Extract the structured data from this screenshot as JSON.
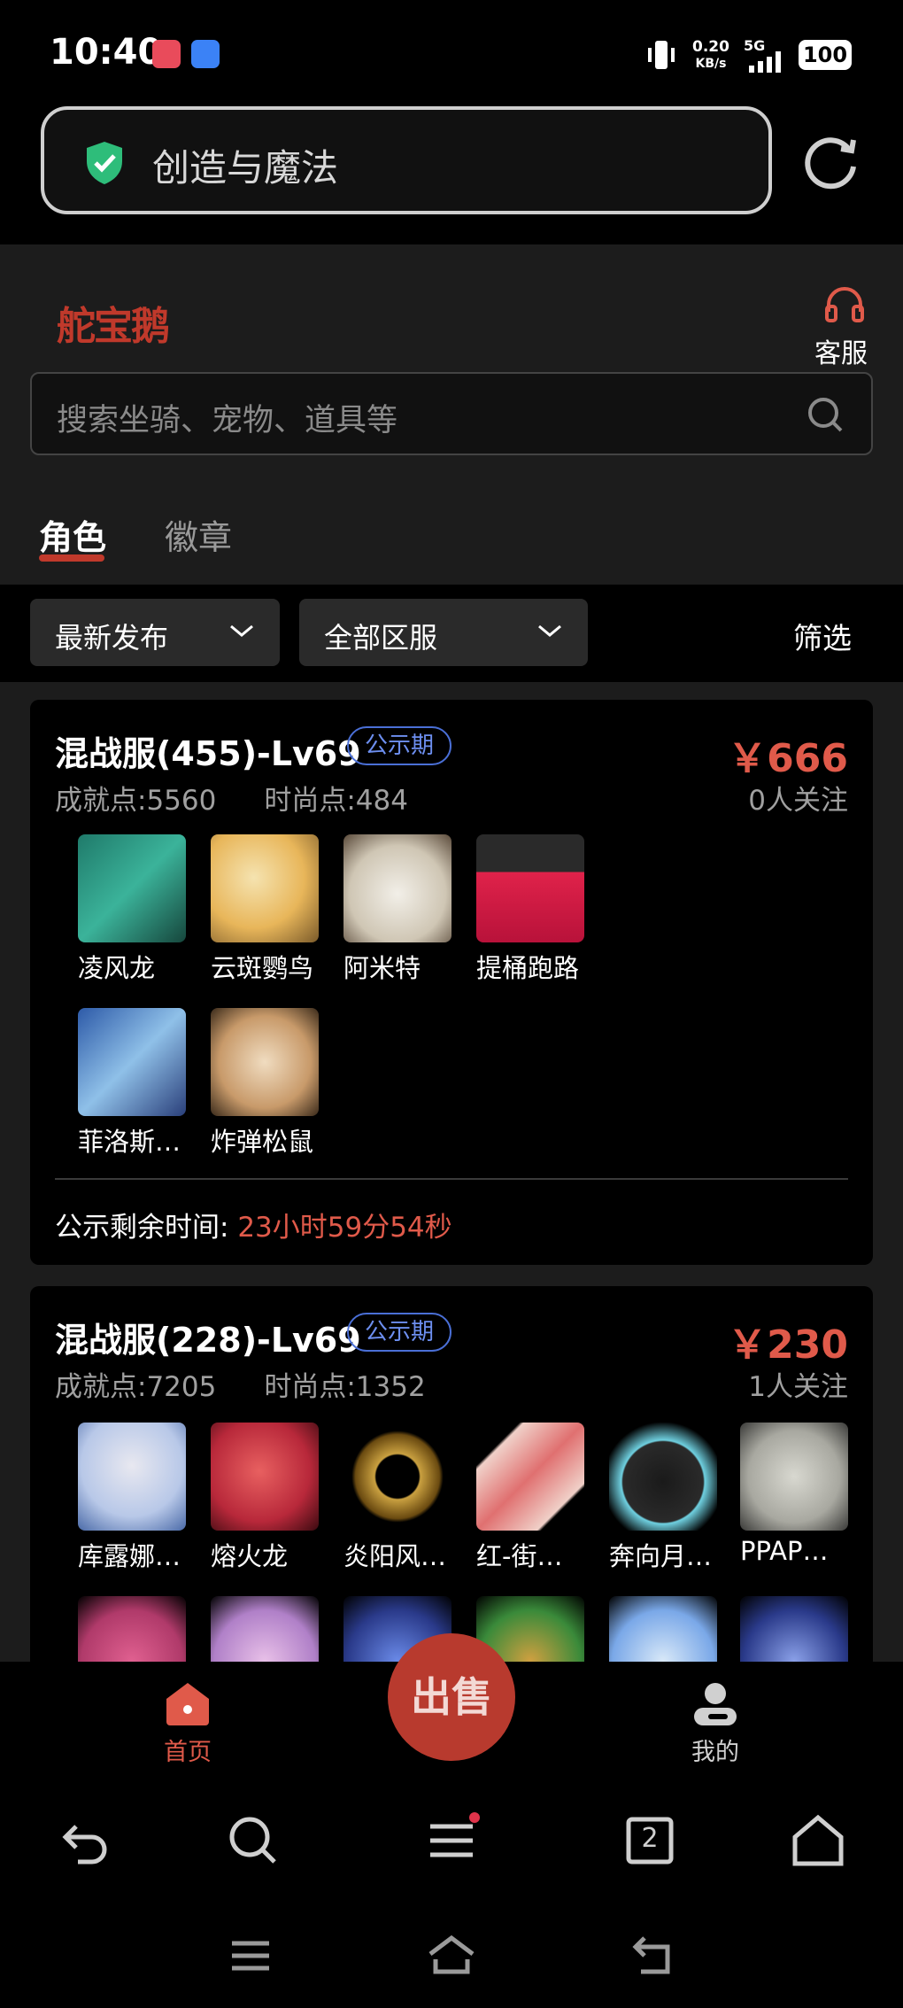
{
  "status_bar": {
    "time": "10:40",
    "network_speed": "0.20",
    "network_unit": "KB/s",
    "network_type": "5G",
    "battery": "100"
  },
  "browser": {
    "url_title": "创造与魔法"
  },
  "header": {
    "logo": "舵宝鹅",
    "service_label": "客服",
    "search_placeholder": "搜索坐骑、宠物、道具等"
  },
  "tabs": [
    {
      "label": "角色",
      "active": true
    },
    {
      "label": "徽章",
      "active": false
    }
  ],
  "filters": {
    "sort": "最新发布",
    "server": "全部区服",
    "filter_label": "筛选"
  },
  "listings": [
    {
      "title": "混战服(455)-Lv69",
      "tag": "公示期",
      "price": "￥666",
      "follow": "0人关注",
      "achievement": "成就点:5560",
      "fashion": "时尚点:484",
      "items": [
        "凌风龙",
        "云斑鹦鸟",
        "阿米特",
        "提桶跑路",
        "菲洛斯…",
        "炸弹松鼠"
      ],
      "remain_label": "公示剩余时间:",
      "remain_time": "23小时59分54秒"
    },
    {
      "title": "混战服(228)-Lv69",
      "tag": "公示期",
      "price": "￥230",
      "follow": "1人关注",
      "achievement": "成就点:7205",
      "fashion": "时尚点:1352",
      "items": [
        "库露娜…",
        "熔火龙",
        "炎阳风…",
        "红-街…",
        "奔向月…",
        "PPAP…"
      ]
    }
  ],
  "app_nav": {
    "home": "首页",
    "sell": "出售",
    "mine": "我的"
  },
  "browser_toolbar": {
    "tab_count": "2"
  },
  "colors": {
    "accent": "#c0392b",
    "price": "#e05a4a",
    "tag": "#4a6fd6",
    "background": "#1c1c1c"
  }
}
